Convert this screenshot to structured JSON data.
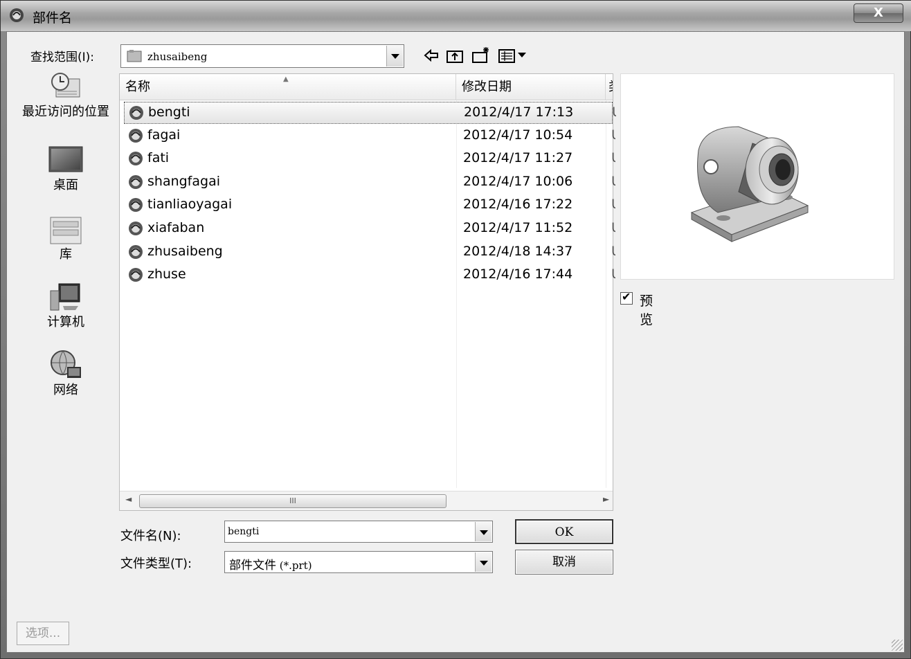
{
  "window": {
    "title": "部件名",
    "close_label": "X"
  },
  "toolbar": {
    "look_in_label": "查找范围(I):",
    "look_in_value": "zhusaibeng",
    "buttons": [
      "back-icon",
      "up-folder-icon",
      "new-folder-icon",
      "view-menu-icon"
    ]
  },
  "places": [
    {
      "label": "最近访问的位置",
      "icon": "recent-places-icon"
    },
    {
      "label": "桌面",
      "icon": "desktop-icon"
    },
    {
      "label": "库",
      "icon": "libraries-icon"
    },
    {
      "label": "计算机",
      "icon": "computer-icon"
    },
    {
      "label": "网络",
      "icon": "network-icon"
    }
  ],
  "file_list": {
    "columns": [
      "名称",
      "修改日期",
      "类"
    ],
    "rows": [
      {
        "name": "bengti",
        "date": "2012/4/17 17:13",
        "type": "U",
        "selected": true
      },
      {
        "name": "fagai",
        "date": "2012/4/17 10:54",
        "type": "U"
      },
      {
        "name": "fati",
        "date": "2012/4/17 11:27",
        "type": "U"
      },
      {
        "name": "shangfagai",
        "date": "2012/4/17 10:06",
        "type": "U"
      },
      {
        "name": "tianliaoyagai",
        "date": "2012/4/16 17:22",
        "type": "U"
      },
      {
        "name": "xiafaban",
        "date": "2012/4/17 11:52",
        "type": "U"
      },
      {
        "name": "zhusaibeng",
        "date": "2012/4/18 14:37",
        "type": "U"
      },
      {
        "name": "zhuse",
        "date": "2012/4/16 17:44",
        "type": "U"
      }
    ],
    "scroll_thumb_label": "III"
  },
  "preview": {
    "checkbox_label": "预览",
    "checked": true
  },
  "file_name": {
    "label": "文件名(N):",
    "value": "bengti"
  },
  "file_type": {
    "label": "文件类型(T):",
    "value_prefix": "部件文件",
    "value_suffix": " (*.prt)"
  },
  "buttons": {
    "ok": "OK",
    "cancel": "取消",
    "options": "选项..."
  }
}
